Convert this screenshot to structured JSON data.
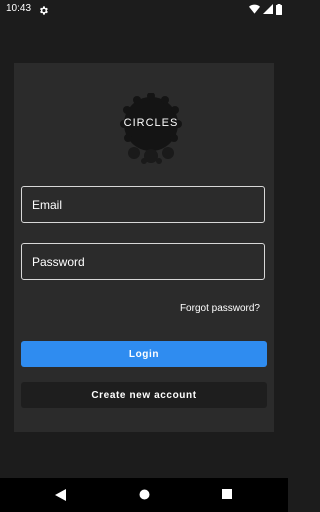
{
  "status_bar": {
    "time": "10:43",
    "icons": [
      "gear-icon",
      "wifi-icon",
      "signal-icon",
      "battery-icon"
    ]
  },
  "app": {
    "logo_text": "CIRCLES"
  },
  "login_form": {
    "email_placeholder": "Email",
    "password_placeholder": "Password",
    "forgot_password": "Forgot password?",
    "login_label": "Login",
    "create_account_label": "Create new account"
  },
  "navigation": {
    "icons": [
      "back-icon",
      "home-icon",
      "recents-icon"
    ]
  },
  "colors": {
    "background": "#1c1c1c",
    "card": "#2b2b2b",
    "accent": "#2f8cf0",
    "secondary_button": "#1e1e1e"
  }
}
